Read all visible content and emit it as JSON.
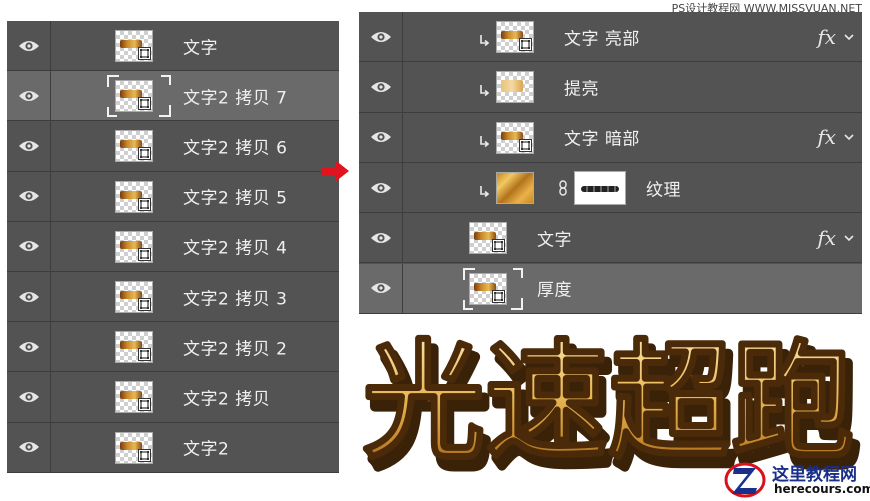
{
  "watermark": "PS设计教程网 WWW.MISSVUAN.NET",
  "left_panel": {
    "layers": [
      {
        "name": "文字",
        "selected": false
      },
      {
        "name": "文字2 拷贝 7",
        "selected": true
      },
      {
        "name": "文字2 拷贝 6",
        "selected": false
      },
      {
        "name": "文字2 拷贝 5",
        "selected": false
      },
      {
        "name": "文字2 拷贝 4",
        "selected": false
      },
      {
        "name": "文字2 拷贝 3",
        "selected": false
      },
      {
        "name": "文字2 拷贝 2",
        "selected": false
      },
      {
        "name": "文字2 拷贝",
        "selected": false
      },
      {
        "name": "文字2",
        "selected": false
      }
    ]
  },
  "right_panel": {
    "fx_label": "fx",
    "layers": [
      {
        "name": "文字 亮部",
        "clipped": true,
        "fx": true
      },
      {
        "name": "提亮",
        "clipped": true,
        "fx": false
      },
      {
        "name": "文字 暗部",
        "clipped": true,
        "fx": true
      },
      {
        "name": "纹理",
        "clipped": true,
        "fx": false,
        "has_mask": true
      },
      {
        "name": "文字",
        "clipped": false,
        "fx": true
      },
      {
        "name": "厚度",
        "clipped": false,
        "fx": false,
        "selected": true
      }
    ]
  },
  "artwork": {
    "title": "光速超跑",
    "gold_light": "#f4d68a",
    "gold_dark": "#8a5412",
    "outline": "#3a2208"
  },
  "site_badge": {
    "name": "这里教程网",
    "domain": "herecours.com"
  },
  "colors": {
    "panel_bg": "#535353",
    "row_selected": "#6a6a6a",
    "arrow": "#e0141e"
  }
}
